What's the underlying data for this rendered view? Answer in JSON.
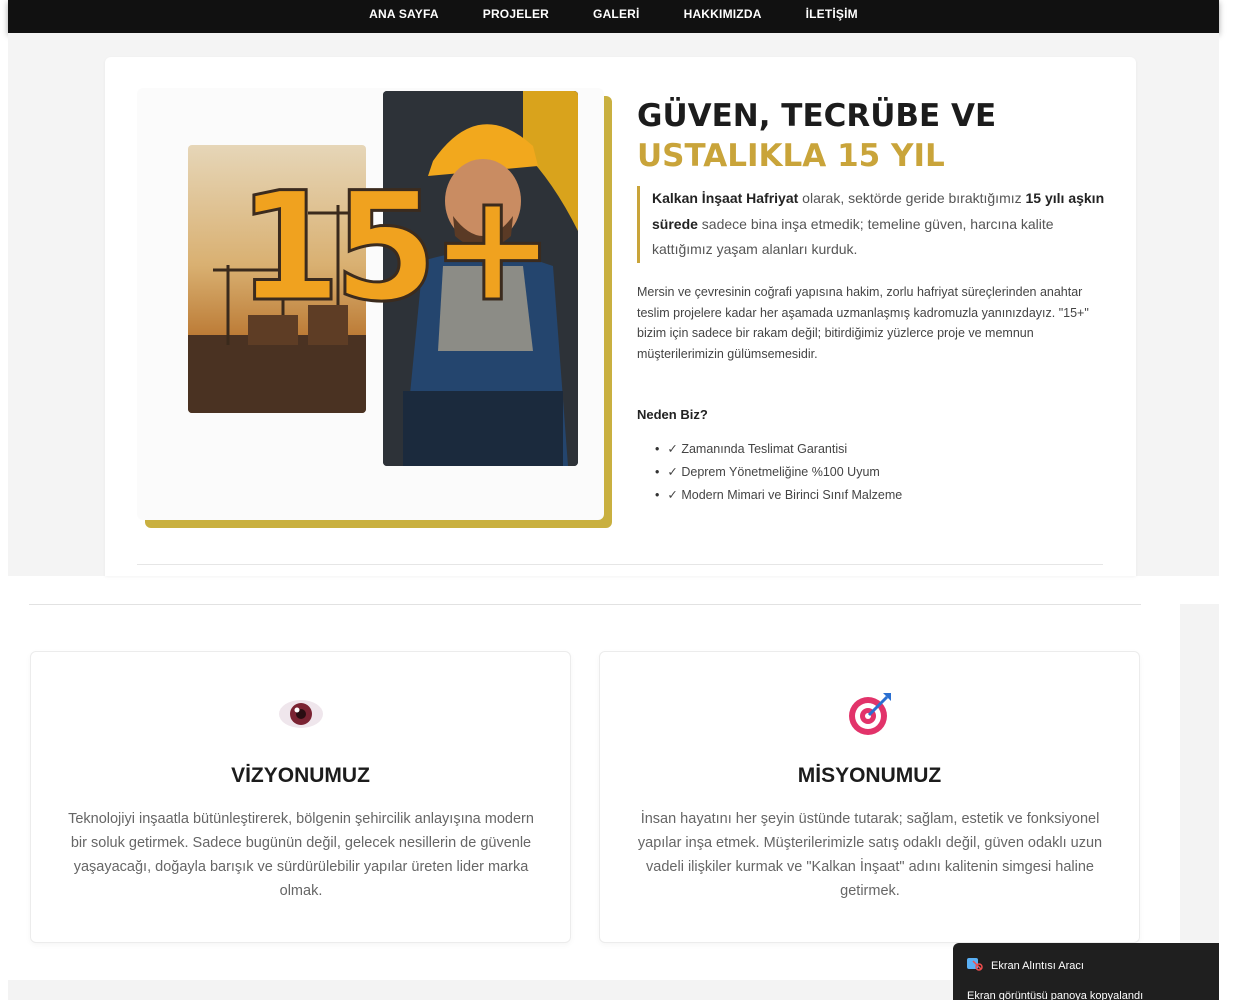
{
  "nav": {
    "items": [
      {
        "label": "ANA SAYFA"
      },
      {
        "label": "PROJELER"
      },
      {
        "label": "GALERİ"
      },
      {
        "label": "HAKKIMIZDA"
      },
      {
        "label": "İLETİŞİM"
      }
    ]
  },
  "about": {
    "image_overlay_text": "15+",
    "headline_line1": "GÜVEN, TECRÜBE VE",
    "headline_line2": "USTALIKLA 15 YIL",
    "lead_company": "Kalkan İnşaat Hafriyat",
    "lead_part1": " olarak, sektörde geride bıraktığımız ",
    "lead_bold": "15 yılı aşkın sürede",
    "lead_part2": " sadece bina inşa etmedik; temeline güven, harcına kalite kattığımız yaşam alanları kurduk.",
    "body": "Mersin ve çevresinin coğrafi yapısına hakim, zorlu hafriyat süreçlerinden anahtar teslim projelere kadar her aşamada uzmanlaşmış kadromuzla yanınızdayız. \"15+\" bizim için sadece bir rakam değil; bitirdiğimiz yüzlerce proje ve memnun müşterilerimizin gülümsemesidir.",
    "why_title": "Neden Biz?",
    "why_items": [
      "✓ Zamanında Teslimat Garantisi",
      "✓ Deprem Yönetmeliğine %100 Uyum",
      "✓ Modern Mimari ve Birinci Sınıf Malzeme"
    ]
  },
  "vision": {
    "icon": "eye-icon",
    "title": "VİZYONUMUZ",
    "text": "Teknolojiyi inşaatla bütünleştirerek, bölgenin şehircilik anlayışına modern bir soluk getirmek. Sadece bugünün değil, gelecek nesillerin de güvenle yaşayacağı, doğayla barışık ve sürdürülebilir yapılar üreten lider marka olmak."
  },
  "mission": {
    "icon": "target-icon",
    "title": "MİSYONUMUZ",
    "text": "İnsan hayatını her şeyin üstünde tutarak; sağlam, estetik ve fonksiyonel yapılar inşa etmek. Müşterilerimizle satış odaklı değil, güven odaklı uzun vadeli ilişkiler kurmak ve \"Kalkan İnşaat\" adını kalitenin simgesi haline getirmek."
  },
  "toast": {
    "app_name": "Ekran Alıntısı Aracı",
    "message": "Ekran görüntüsü panoya kopyalandı"
  },
  "colors": {
    "accent_gold": "#c9a43a",
    "nav_bg": "#111111",
    "heading": "#1c1c1c"
  }
}
